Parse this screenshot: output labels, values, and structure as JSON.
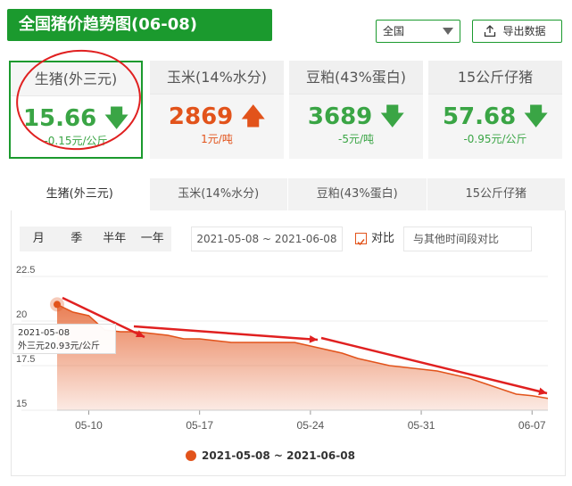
{
  "header": {
    "title": "全国猪价趋势图(06-08)"
  },
  "region": {
    "selected": "全国"
  },
  "export": {
    "label": "导出数据"
  },
  "cards": [
    {
      "title": "生猪(外三元)",
      "value": "15.66",
      "dir": "down",
      "change": "-0.15元/公斤"
    },
    {
      "title": "玉米(14%水分)",
      "value": "2869",
      "dir": "up",
      "change": "1元/吨"
    },
    {
      "title": "豆粕(43%蛋白)",
      "value": "3689",
      "dir": "down",
      "change": "-5元/吨"
    },
    {
      "title": "15公斤仔猪",
      "value": "57.68",
      "dir": "down",
      "change": "-0.95元/公斤"
    }
  ],
  "tabs": [
    "生猪(外三元)",
    "玉米(14%水分)",
    "豆粕(43%蛋白)",
    "15公斤仔猪"
  ],
  "periods": [
    "月",
    "季",
    "半年",
    "一年"
  ],
  "date_range": "2021-05-08 ~ 2021-06-08",
  "compare": {
    "label": "对比",
    "placeholder": "与其他时间段对比"
  },
  "tooltip": {
    "date": "2021-05-08",
    "text": "外三元20.93元/公斤"
  },
  "legend": {
    "label": "2021-05-08 ~ 2021-06-08"
  },
  "colors": {
    "green": "#1b9a2e",
    "up": "#e2531b",
    "down": "#3aa545",
    "area": "#e2531b"
  },
  "chart_data": {
    "type": "area",
    "x": [
      "2021-05-08",
      "2021-05-09",
      "2021-05-10",
      "2021-05-11",
      "2021-05-12",
      "2021-05-13",
      "2021-05-14",
      "2021-05-15",
      "2021-05-16",
      "2021-05-17",
      "2021-05-18",
      "2021-05-19",
      "2021-05-20",
      "2021-05-21",
      "2021-05-22",
      "2021-05-23",
      "2021-05-24",
      "2021-05-25",
      "2021-05-26",
      "2021-05-27",
      "2021-05-28",
      "2021-05-29",
      "2021-05-30",
      "2021-05-31",
      "2021-06-01",
      "2021-06-02",
      "2021-06-03",
      "2021-06-04",
      "2021-06-05",
      "2021-06-06",
      "2021-06-07",
      "2021-06-08"
    ],
    "values": [
      20.93,
      20.5,
      20.3,
      19.5,
      19.4,
      19.4,
      19.3,
      19.2,
      19.0,
      19.0,
      18.9,
      18.8,
      18.8,
      18.8,
      18.8,
      18.8,
      18.6,
      18.4,
      18.2,
      17.9,
      17.7,
      17.5,
      17.4,
      17.3,
      17.2,
      17.0,
      16.8,
      16.5,
      16.2,
      15.9,
      15.81,
      15.66
    ],
    "xticks": [
      "05-10",
      "05-17",
      "05-24",
      "05-31",
      "06-07"
    ],
    "yticks": [
      "22.5",
      "20",
      "17.5",
      "15"
    ],
    "ylim": [
      15,
      22.5
    ],
    "grid": true
  }
}
